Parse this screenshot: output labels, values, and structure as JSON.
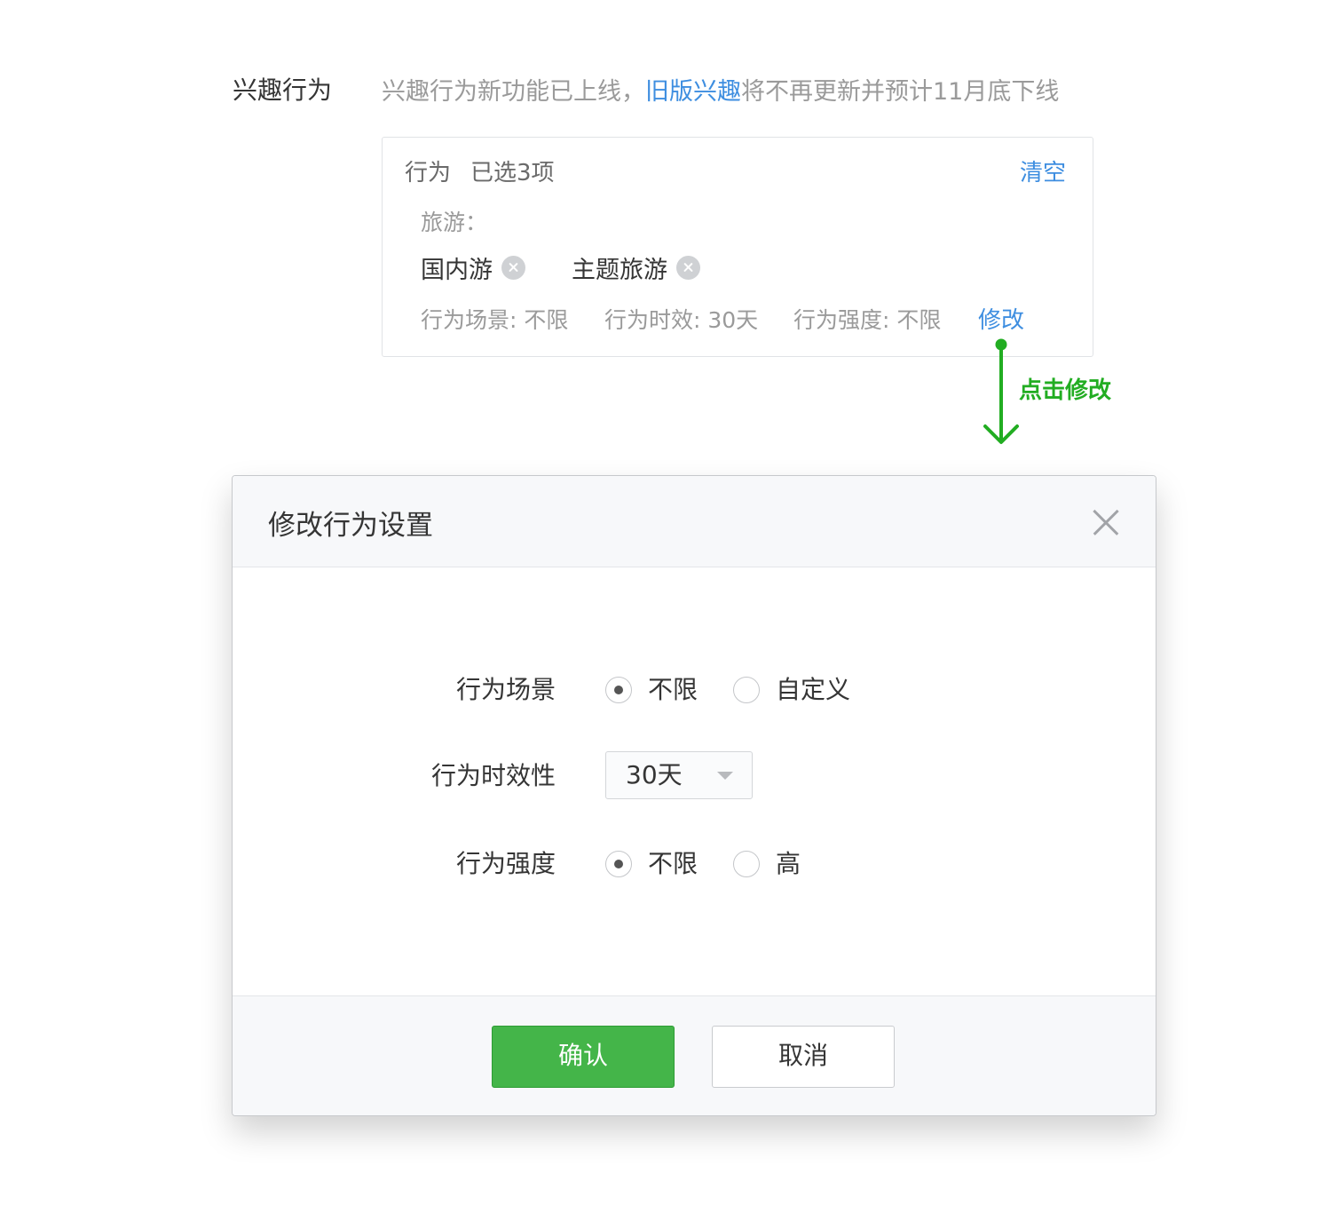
{
  "section": {
    "label": "兴趣行为",
    "notice_before": "兴趣行为新功能已上线，",
    "notice_link": "旧版兴趣",
    "notice_after": "将不再更新并预计11月底下线"
  },
  "card": {
    "title": "行为",
    "selected_count": "已选3项",
    "clear_label": "清空",
    "category": "旅游：",
    "tags": [
      "国内游",
      "主题旅游"
    ],
    "meta": {
      "scene": "行为场景: 不限",
      "validity": "行为时效: 30天",
      "intensity": "行为强度: 不限"
    },
    "edit_label": "修改"
  },
  "annotation": {
    "hint": "点击修改",
    "color": "#22ad22"
  },
  "dialog": {
    "title": "修改行为设置",
    "rows": {
      "scene": {
        "label": "行为场景",
        "options": [
          "不限",
          "自定义"
        ],
        "selected": "不限"
      },
      "validity": {
        "label": "行为时效性",
        "value": "30天"
      },
      "intensity": {
        "label": "行为强度",
        "options": [
          "不限",
          "高"
        ],
        "selected": "不限"
      }
    },
    "confirm_label": "确认",
    "cancel_label": "取消"
  },
  "colors": {
    "link": "#3e8ee0",
    "primary_button": "#44b549",
    "annotation_green": "#22ad22"
  }
}
